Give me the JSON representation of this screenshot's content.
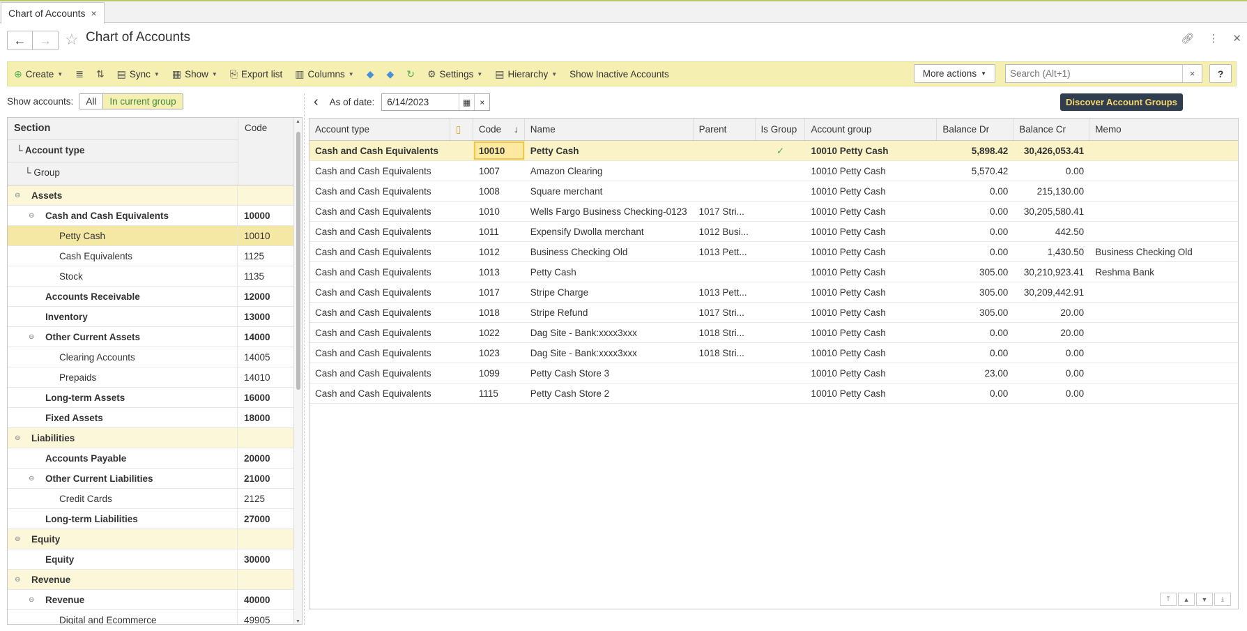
{
  "tab": {
    "label": "Chart of Accounts"
  },
  "header": {
    "title": "Chart of Accounts"
  },
  "toolbar": {
    "create": "Create",
    "sync": "Sync",
    "show": "Show",
    "export": "Export list",
    "columns": "Columns",
    "settings": "Settings",
    "hierarchy": "Hierarchy",
    "inactive": "Show Inactive Accounts",
    "more_actions": "More actions",
    "search_placeholder": "Search (Alt+1)",
    "help": "?"
  },
  "filter": {
    "label": "Show accounts:",
    "all": "All",
    "current": "In current group"
  },
  "date": {
    "label": "As of date:",
    "value": "6/14/2023"
  },
  "discover": "Discover Account Groups",
  "tree_header": {
    "section": "Section",
    "account_type": "Account type",
    "group": "Group",
    "code": "Code"
  },
  "tree": [
    {
      "name": "Assets",
      "code": "",
      "level": 0,
      "kind": "section"
    },
    {
      "name": "Cash and Cash Equivalents",
      "code": "10000",
      "level": 1,
      "kind": "group"
    },
    {
      "name": "Petty Cash",
      "code": "10010",
      "level": 2,
      "kind": "selected"
    },
    {
      "name": "Cash Equivalents",
      "code": "1125",
      "level": 2,
      "kind": "leaf"
    },
    {
      "name": "Stock",
      "code": "1135",
      "level": 2,
      "kind": "leaf"
    },
    {
      "name": "Accounts Receivable",
      "code": "12000",
      "level": 1,
      "kind": "type"
    },
    {
      "name": "Inventory",
      "code": "13000",
      "level": 1,
      "kind": "type"
    },
    {
      "name": "Other Current Assets",
      "code": "14000",
      "level": 1,
      "kind": "group"
    },
    {
      "name": "Clearing Accounts",
      "code": "14005",
      "level": 2,
      "kind": "leaf"
    },
    {
      "name": "Prepaids",
      "code": "14010",
      "level": 2,
      "kind": "leaf"
    },
    {
      "name": "Long-term Assets",
      "code": "16000",
      "level": 1,
      "kind": "type"
    },
    {
      "name": "Fixed Assets",
      "code": "18000",
      "level": 1,
      "kind": "type"
    },
    {
      "name": "Liabilities",
      "code": "",
      "level": 0,
      "kind": "section"
    },
    {
      "name": "Accounts Payable",
      "code": "20000",
      "level": 1,
      "kind": "type"
    },
    {
      "name": "Other Current Liabilities",
      "code": "21000",
      "level": 1,
      "kind": "group"
    },
    {
      "name": "Credit Cards",
      "code": "2125",
      "level": 2,
      "kind": "leaf"
    },
    {
      "name": "Long-term Liabilities",
      "code": "27000",
      "level": 1,
      "kind": "type"
    },
    {
      "name": "Equity",
      "code": "",
      "level": 0,
      "kind": "section"
    },
    {
      "name": "Equity",
      "code": "30000",
      "level": 1,
      "kind": "type"
    },
    {
      "name": "Revenue",
      "code": "",
      "level": 0,
      "kind": "section"
    },
    {
      "name": "Revenue",
      "code": "40000",
      "level": 1,
      "kind": "group"
    },
    {
      "name": "Digital and Ecommerce",
      "code": "49905",
      "level": 2,
      "kind": "leaf"
    }
  ],
  "grid": {
    "columns": [
      "Account type",
      "",
      "Code",
      "Name",
      "Parent",
      "Is Group",
      "Account group",
      "Balance Dr",
      "Balance Cr",
      "Memo"
    ],
    "rows": [
      [
        "Cash and Cash Equivalents",
        "10010",
        "Petty Cash",
        "",
        "✓",
        "10010 Petty Cash",
        "5,898.42",
        "30,426,053.41",
        ""
      ],
      [
        "Cash and Cash Equivalents",
        "1007",
        "Amazon Clearing",
        "",
        "",
        "10010 Petty Cash",
        "5,570.42",
        "0.00",
        ""
      ],
      [
        "Cash and Cash Equivalents",
        "1008",
        "Square merchant",
        "",
        "",
        "10010 Petty Cash",
        "0.00",
        "215,130.00",
        ""
      ],
      [
        "Cash and Cash Equivalents",
        "1010",
        "Wells Fargo Business Checking-0123",
        "1017 Stri...",
        "",
        "10010 Petty Cash",
        "0.00",
        "30,205,580.41",
        ""
      ],
      [
        "Cash and Cash Equivalents",
        "1011",
        "Expensify Dwolla merchant",
        "1012 Busi...",
        "",
        "10010 Petty Cash",
        "0.00",
        "442.50",
        ""
      ],
      [
        "Cash and Cash Equivalents",
        "1012",
        "Business Checking Old",
        "1013 Pett...",
        "",
        "10010 Petty Cash",
        "0.00",
        "1,430.50",
        "Business Checking Old"
      ],
      [
        "Cash and Cash Equivalents",
        "1013",
        "Petty Cash",
        "",
        "",
        "10010 Petty Cash",
        "305.00",
        "30,210,923.41",
        "Reshma Bank"
      ],
      [
        "Cash and Cash Equivalents",
        "1017",
        "Stripe Charge",
        "1013 Pett...",
        "",
        "10010 Petty Cash",
        "305.00",
        "30,209,442.91",
        ""
      ],
      [
        "Cash and Cash Equivalents",
        "1018",
        "Stripe Refund",
        "1017 Stri...",
        "",
        "10010 Petty Cash",
        "305.00",
        "20.00",
        ""
      ],
      [
        "Cash and Cash Equivalents",
        "1022",
        "Dag Site - Bank:xxxx3xxx",
        "1018 Stri...",
        "",
        "10010 Petty Cash",
        "0.00",
        "20.00",
        ""
      ],
      [
        "Cash and Cash Equivalents",
        "1023",
        "Dag Site - Bank:xxxx3xxx",
        "1018 Stri...",
        "",
        "10010 Petty Cash",
        "0.00",
        "0.00",
        ""
      ],
      [
        "Cash and Cash Equivalents",
        "1099",
        "Petty Cash Store 3",
        "",
        "",
        "10010 Petty Cash",
        "23.00",
        "0.00",
        ""
      ],
      [
        "Cash and Cash Equivalents",
        "1115",
        "Petty Cash Store 2",
        "",
        "",
        "10010 Petty Cash",
        "0.00",
        "0.00",
        ""
      ]
    ]
  }
}
